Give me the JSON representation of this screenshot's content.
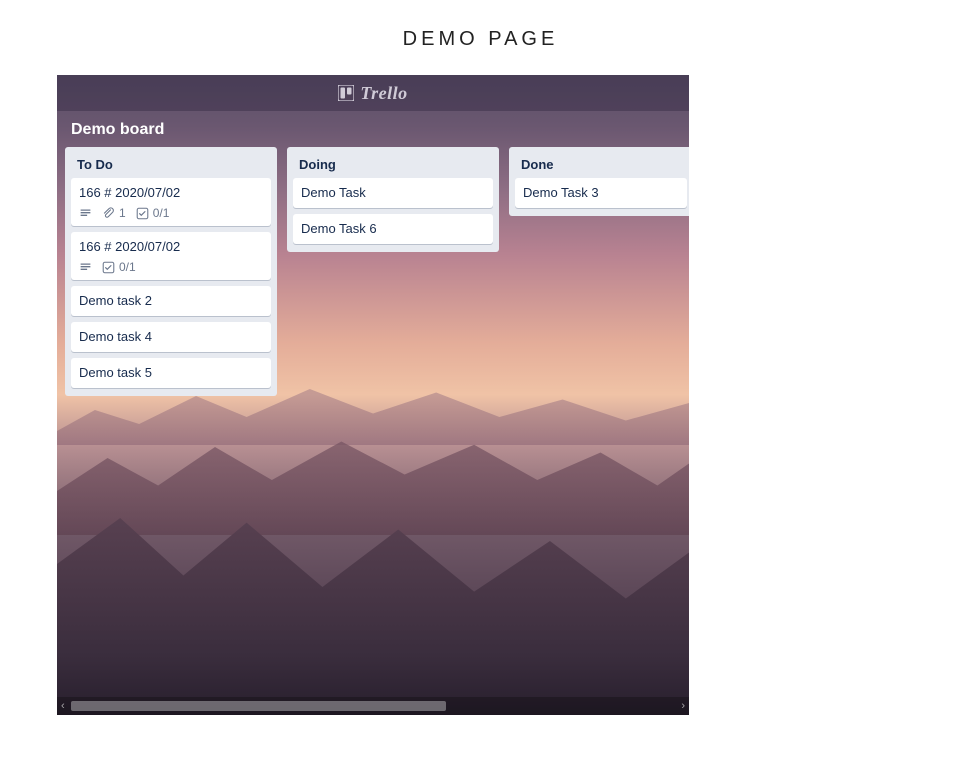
{
  "page": {
    "title": "DEMO PAGE"
  },
  "app": {
    "logo_text": "Trello"
  },
  "board": {
    "name": "Demo board"
  },
  "lists": [
    {
      "title": "To Do",
      "cards": [
        {
          "title": "166 # 2020/07/02",
          "badges": {
            "description": true,
            "attachments": "1",
            "checklist": "0/1"
          }
        },
        {
          "title": "166 # 2020/07/02",
          "badges": {
            "description": true,
            "checklist": "0/1"
          }
        },
        {
          "title": "Demo task 2"
        },
        {
          "title": "Demo task 4"
        },
        {
          "title": "Demo task 5"
        }
      ]
    },
    {
      "title": "Doing",
      "cards": [
        {
          "title": "Demo Task"
        },
        {
          "title": "Demo Task 6"
        }
      ]
    },
    {
      "title": "Done",
      "cards": [
        {
          "title": "Demo Task 3"
        }
      ]
    }
  ]
}
